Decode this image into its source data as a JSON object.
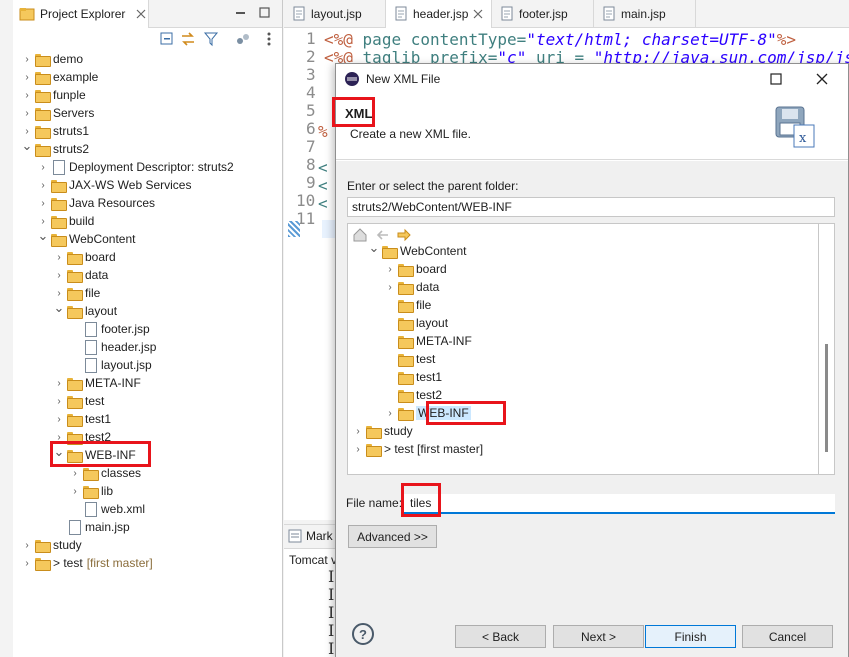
{
  "project_explorer": {
    "title": "Project Explorer",
    "tree": [
      {
        "label": "demo",
        "type": "project",
        "expanded": false
      },
      {
        "label": "example",
        "type": "project",
        "expanded": false
      },
      {
        "label": "funple",
        "type": "project",
        "expanded": false
      },
      {
        "label": "Servers",
        "type": "folder",
        "expanded": false
      },
      {
        "label": "struts1",
        "type": "project",
        "expanded": false
      },
      {
        "label": "struts2",
        "type": "project",
        "expanded": true
      },
      {
        "label": "Deployment Descriptor: struts2",
        "type": "descriptor"
      },
      {
        "label": "JAX-WS Web Services",
        "type": "ws"
      },
      {
        "label": "Java Resources",
        "type": "java"
      },
      {
        "label": "build",
        "type": "folder"
      },
      {
        "label": "WebContent",
        "type": "folder",
        "expanded": true
      },
      {
        "label": "board",
        "type": "folder"
      },
      {
        "label": "data",
        "type": "folder"
      },
      {
        "label": "file",
        "type": "folder"
      },
      {
        "label": "layout",
        "type": "folder",
        "expanded": true
      },
      {
        "label": "footer.jsp",
        "type": "file"
      },
      {
        "label": "header.jsp",
        "type": "file"
      },
      {
        "label": "layout.jsp",
        "type": "file"
      },
      {
        "label": "META-INF",
        "type": "folder"
      },
      {
        "label": "test",
        "type": "folder"
      },
      {
        "label": "test1",
        "type": "folder"
      },
      {
        "label": "test2",
        "type": "folder"
      },
      {
        "label": "WEB-INF",
        "type": "folder",
        "expanded": true
      },
      {
        "label": "classes",
        "type": "folder"
      },
      {
        "label": "lib",
        "type": "folder"
      },
      {
        "label": "web.xml",
        "type": "xml"
      },
      {
        "label": "main.jsp",
        "type": "file"
      },
      {
        "label": "study",
        "type": "project"
      },
      {
        "label": "> test",
        "extra": "[first master]",
        "type": "project"
      }
    ]
  },
  "editor": {
    "tabs": [
      "layout.jsp",
      "header.jsp",
      "footer.jsp",
      "main.jsp"
    ],
    "active_tab": "header.jsp",
    "line_numbers": [
      "1",
      "2",
      "3",
      "4",
      "5",
      "6",
      "7",
      "8",
      "9",
      "10",
      "11"
    ],
    "line1": {
      "open": "<%@",
      "kw": "page",
      "attr": "contentType=",
      "val": "\"text/html; charset=UTF-8\"",
      "close": "%>"
    },
    "line2": {
      "open": "<%@",
      "kw": "taglib",
      "attr": "prefix=",
      "val": "\"c\"",
      "attr2": "uri =",
      "val2": "\"http://java.sun.com/jsp/jstl/"
    }
  },
  "bottom_panel": {
    "tab_label": "Mark",
    "server_label": "Tomcat v",
    "lines": [
      "I",
      "I",
      "I",
      "I",
      "I"
    ]
  },
  "dialog": {
    "title": "New XML File",
    "heading": "XML",
    "description": "Create a new XML file.",
    "parent_folder_label": "Enter or select the parent folder:",
    "parent_folder_value": "struts2/WebContent/WEB-INF",
    "folder_tree": [
      {
        "label": "WebContent",
        "expanded": true
      },
      {
        "label": "board",
        "has_children": true
      },
      {
        "label": "data",
        "has_children": true
      },
      {
        "label": "file"
      },
      {
        "label": "layout"
      },
      {
        "label": "META-INF"
      },
      {
        "label": "test"
      },
      {
        "label": "test1"
      },
      {
        "label": "test2"
      },
      {
        "label": "WEB-INF",
        "selected": true,
        "has_children": true
      },
      {
        "label": "study",
        "project": true
      },
      {
        "label": "> test [first master]",
        "project": true
      }
    ],
    "file_name_label": "File name:",
    "file_name_value": "tiles",
    "advanced_button": "Advanced >>",
    "back_button": "< Back",
    "next_button": "Next >",
    "finish_button": "Finish",
    "cancel_button": "Cancel",
    "help_icon": "?"
  }
}
